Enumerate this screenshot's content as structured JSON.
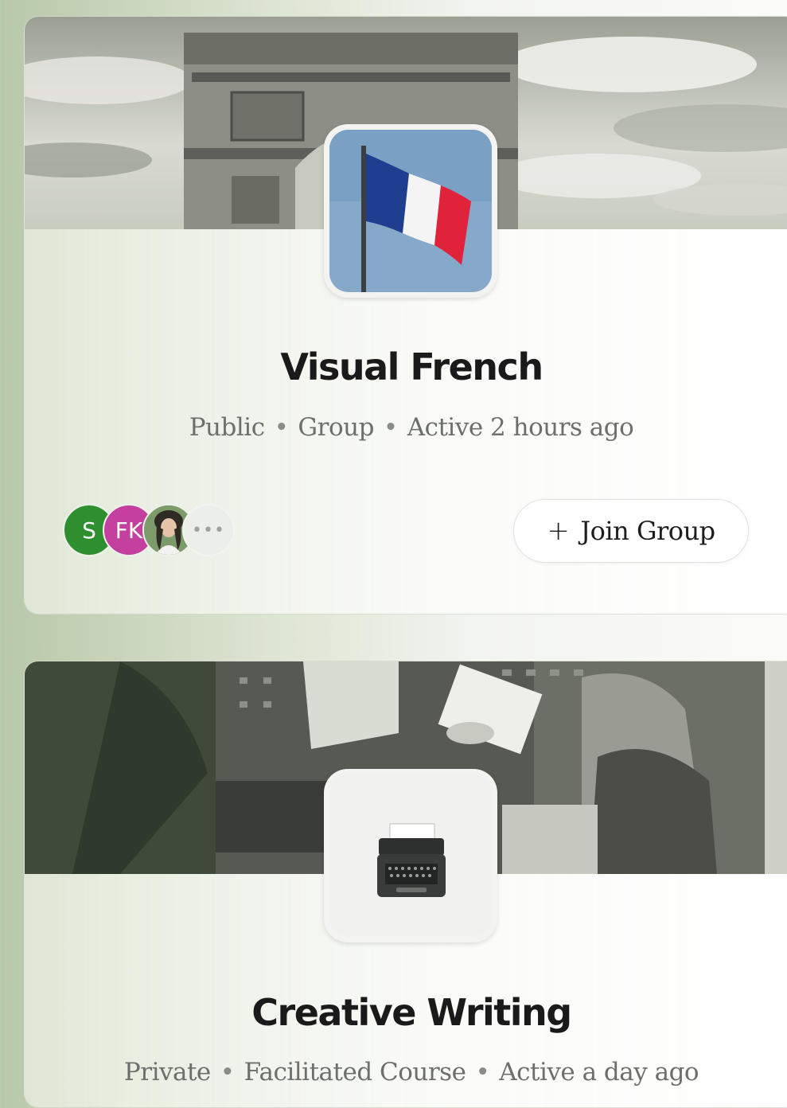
{
  "groups": [
    {
      "title": "Visual French",
      "visibility": "Public",
      "type": "Group",
      "activity": "Active 2 hours ago",
      "banner_image": "arc-de-triomphe-photo",
      "icon_image": "french-flag-photo",
      "members": [
        {
          "initials": "S",
          "color": "#2e8f2f"
        },
        {
          "initials": "FK",
          "color": "#c4409f"
        },
        {
          "initials": "",
          "image": "member-photo"
        }
      ],
      "more_members": "•••",
      "join_label": "Join Group",
      "join_icon": "+"
    },
    {
      "title": "Creative Writing",
      "visibility": "Private",
      "type": "Facilitated Course",
      "activity": "Active a day ago",
      "banner_image": "typewriter-workshop-photo",
      "icon_image": "typewriter-photo"
    }
  ],
  "separator": "•"
}
